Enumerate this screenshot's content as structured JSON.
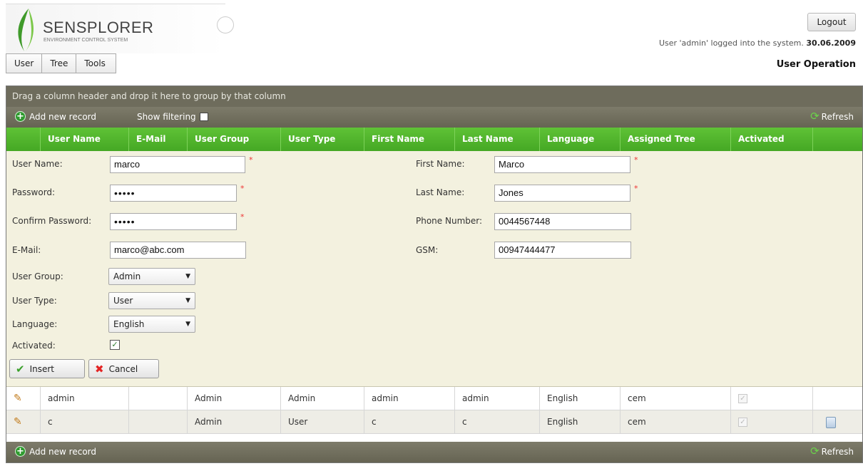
{
  "header": {
    "logo_title": "SENSPLORER",
    "logo_subtitle": "ENVIRONMENT CONTROL SYSTEM",
    "logout_label": "Logout",
    "login_status": "User 'admin' logged into the system.",
    "login_date": "30.06.2009"
  },
  "menu": {
    "items": [
      "User",
      "Tree",
      "Tools"
    ]
  },
  "page_label": "User Operation",
  "grid": {
    "group_hint": "Drag a column header and drop it here to group by that column",
    "add_record": "Add new record",
    "show_filtering": "Show filtering",
    "refresh": "Refresh",
    "columns": [
      "User Name",
      "E-Mail",
      "User Group",
      "User Type",
      "First Name",
      "Last Name",
      "Language",
      "Assigned Tree",
      "Activated"
    ],
    "rows": [
      {
        "user_name": "admin",
        "email": "",
        "user_group": "Admin",
        "user_type": "Admin",
        "first_name": "admin",
        "last_name": "admin",
        "language": "English",
        "assigned_tree": "cem",
        "activated": true
      },
      {
        "user_name": "c",
        "email": "",
        "user_group": "Admin",
        "user_type": "User",
        "first_name": "c",
        "last_name": "c",
        "language": "English",
        "assigned_tree": "cem",
        "activated": true
      }
    ]
  },
  "form": {
    "user_name_label": "User Name:",
    "user_name_value": "marco",
    "password_label": "Password:",
    "password_value": "•••••",
    "confirm_password_label": "Confirm Password:",
    "confirm_password_value": "•••••",
    "email_label": "E-Mail:",
    "email_value": "marco@abc.com",
    "user_group_label": "User Group:",
    "user_group_value": "Admin",
    "user_type_label": "User Type:",
    "user_type_value": "User",
    "language_label": "Language:",
    "language_value": "English",
    "activated_label": "Activated:",
    "activated_value": true,
    "first_name_label": "First Name:",
    "first_name_value": "Marco",
    "last_name_label": "Last Name:",
    "last_name_value": "Jones",
    "phone_label": "Phone Number:",
    "phone_value": "0044567448",
    "gsm_label": "GSM:",
    "gsm_value": "00947444477",
    "required_mark": "*",
    "insert_label": "Insert",
    "cancel_label": "Cancel"
  },
  "colors": {
    "header_green": "#4fb22a",
    "toolbar_olive": "#6e6c5c",
    "form_bg": "#f3f1df"
  }
}
